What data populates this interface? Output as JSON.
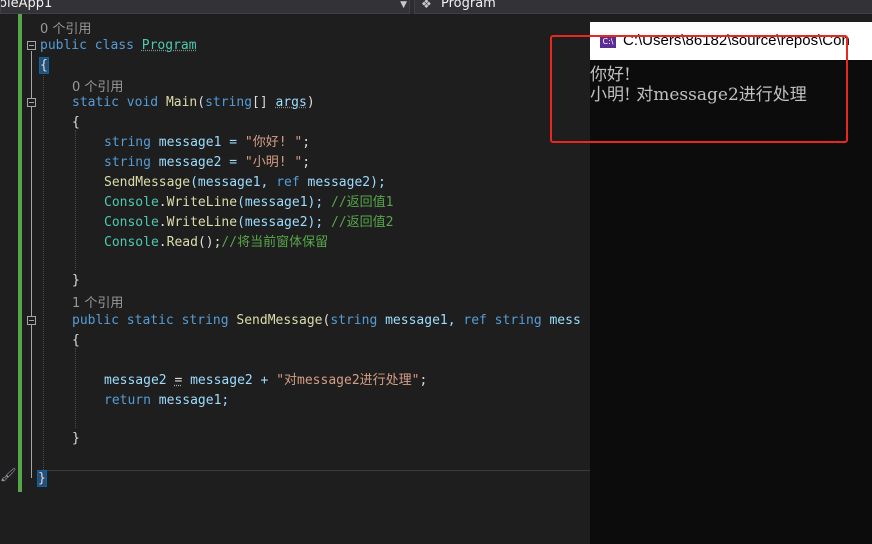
{
  "toolbar": {
    "project_dropdown": "oleApp1",
    "member_dropdown": "Program"
  },
  "editor": {
    "codelens": {
      "class_refs": "0 个引用",
      "main_refs": "0 个引用",
      "sendmessage_refs": "1 个引用"
    },
    "lines": {
      "class_decl": {
        "kw1": "public",
        "kw2": "class",
        "name": "Program"
      },
      "open_brace": "{",
      "main_decl": {
        "kw1": "static",
        "kw2": "void",
        "name": "Main",
        "sig1": "(",
        "type": "string",
        "sig2": "[] ",
        "param": "args",
        "sig3": ")"
      },
      "main_open": "{",
      "l1": {
        "type": "string",
        "rest": " message1 = ",
        "str": "\"你好! \"",
        "end": ";"
      },
      "l2": {
        "type": "string",
        "rest": " message2 = ",
        "str": "\"小明! \"",
        "end": ";"
      },
      "l3": {
        "method": "SendMessage",
        "a": "(message1, ",
        "kw": "ref",
        "b": " message2);"
      },
      "l4": {
        "cls": "Console",
        "dot": ".",
        "method": "WriteLine",
        "args": "(message1); ",
        "cmt": "//返回值1"
      },
      "l5": {
        "cls": "Console",
        "dot": ".",
        "method": "WriteLine",
        "args": "(message2); ",
        "cmt": "//返回值2"
      },
      "l6": {
        "cls": "Console",
        "dot": ".",
        "method": "Read",
        "args": "();",
        "cmt": "//将当前窗体保留"
      },
      "main_close": "}",
      "send_decl": {
        "kw1": "public",
        "kw2": "static",
        "kw3": "string",
        "name": "SendMessage",
        "a": "(",
        "t1": "string",
        "p1": " message1, ",
        "kw4": "ref",
        "t2": " string",
        "p2": " mess"
      },
      "send_open": "{",
      "s1": {
        "a": "message2 ",
        "op": "=",
        "b": " message2 + ",
        "str": "\"对message2进行处理\"",
        "end": ";"
      },
      "s2": {
        "kw": "return",
        "rest": " message1;"
      },
      "send_close": "}",
      "class_close": "}"
    }
  },
  "console": {
    "title": "C:\\Users\\86182\\source\\repos\\Con",
    "icon_text": "C:\\",
    "output": [
      "你好!",
      "小明! 对message2进行处理"
    ]
  },
  "colors": {
    "highlight_box": "#e8271f",
    "change_bar": "#57a64a"
  }
}
